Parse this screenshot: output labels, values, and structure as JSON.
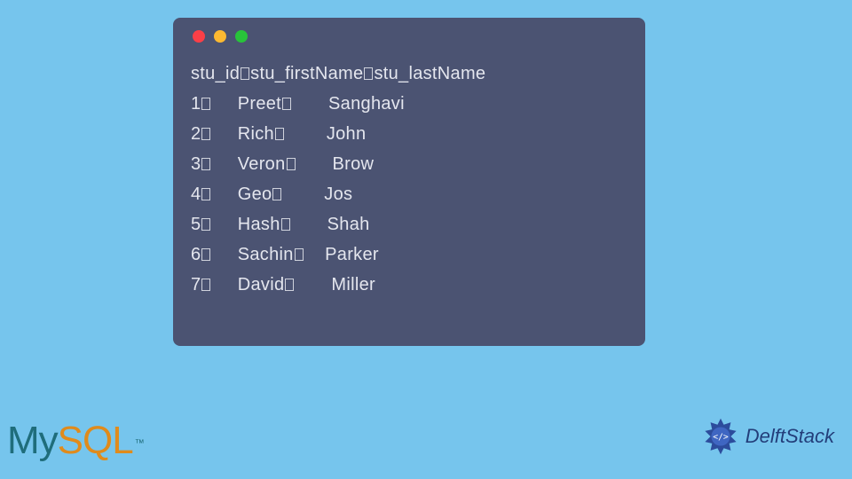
{
  "terminal": {
    "lights": [
      "red",
      "yellow",
      "green"
    ],
    "header": {
      "c0": "stu_id",
      "c1": "stu_firstName",
      "c2": "stu_lastName"
    },
    "rows": [
      {
        "id": "1",
        "first": "Preet",
        "last": "Sanghavi"
      },
      {
        "id": "2",
        "first": "Rich",
        "last": "John"
      },
      {
        "id": "3",
        "first": "Veron",
        "last": "Brow"
      },
      {
        "id": "4",
        "first": "Geo",
        "last": "Jos"
      },
      {
        "id": "5",
        "first": "Hash",
        "last": "Shah"
      },
      {
        "id": "6",
        "first": "Sachin",
        "last": "Parker"
      },
      {
        "id": "7",
        "first": "David",
        "last": "Miller"
      }
    ]
  },
  "branding": {
    "mysql_my": "My",
    "mysql_sql": "SQL",
    "mysql_tm": "™",
    "delftstack": "DelftStack"
  },
  "chart_data": {
    "type": "table",
    "columns": [
      "stu_id",
      "stu_firstName",
      "stu_lastName"
    ],
    "rows": [
      [
        1,
        "Preet",
        "Sanghavi"
      ],
      [
        2,
        "Rich",
        "John"
      ],
      [
        3,
        "Veron",
        "Brow"
      ],
      [
        4,
        "Geo",
        "Jos"
      ],
      [
        5,
        "Hash",
        "Shah"
      ],
      [
        6,
        "Sachin",
        "Parker"
      ],
      [
        7,
        "David",
        "Miller"
      ]
    ]
  }
}
